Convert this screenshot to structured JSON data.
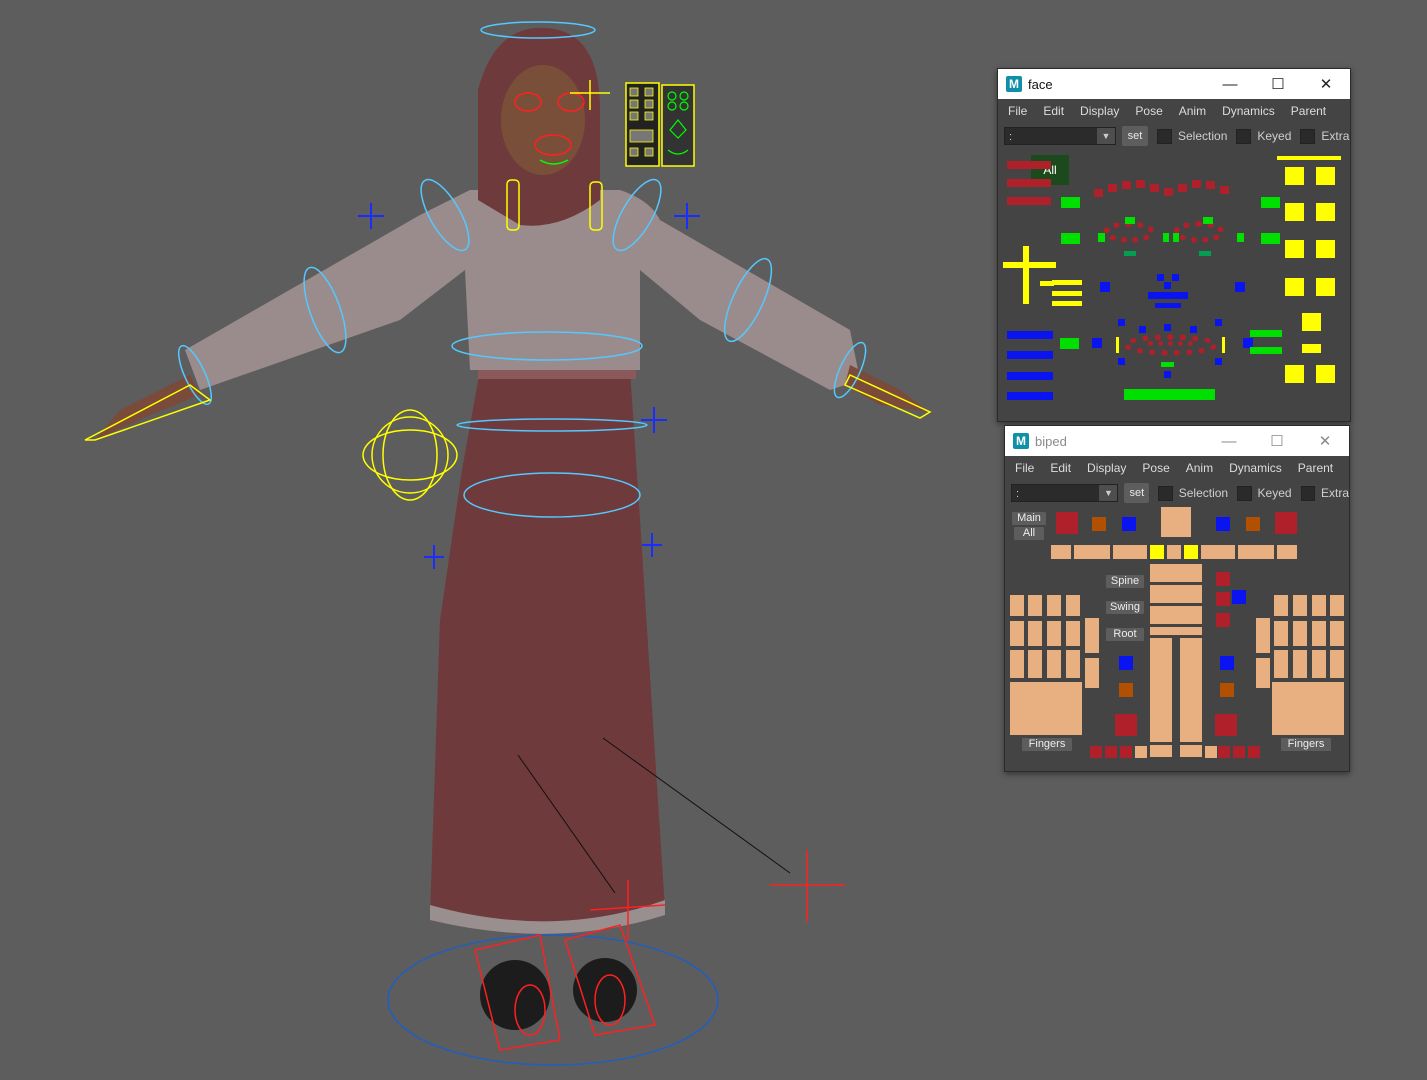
{
  "windows": {
    "face": {
      "title": "face",
      "menus": [
        "File",
        "Edit",
        "Display",
        "Pose",
        "Anim",
        "Dynamics",
        "Parent"
      ],
      "combo_value": ":",
      "set_label": "set",
      "checkboxes": [
        "Selection",
        "Keyed",
        "Extra"
      ],
      "all_label": "All"
    },
    "biped": {
      "title": "biped",
      "menus": [
        "File",
        "Edit",
        "Display",
        "Pose",
        "Anim",
        "Dynamics",
        "Parent"
      ],
      "combo_value": ":",
      "set_label": "set",
      "checkboxes": [
        "Selection",
        "Keyed",
        "Extra"
      ],
      "labels": {
        "main": "Main",
        "all": "All",
        "spine": "Spine",
        "swing": "Swing",
        "root": "Root",
        "fingers_left": "Fingers",
        "fingers_right": "Fingers"
      }
    }
  },
  "window_controls": {
    "minimize": "—",
    "maximize": "☐",
    "close": "✕"
  },
  "colors": {
    "viewport_bg": "#5d5d5d",
    "ctrl_red": "#b0202a",
    "ctrl_green": "#00e000",
    "ctrl_blue": "#0a14f0",
    "ctrl_yellow": "#ffff00",
    "ctrl_skin": "#e8b080",
    "ctrl_orange": "#b05000"
  }
}
